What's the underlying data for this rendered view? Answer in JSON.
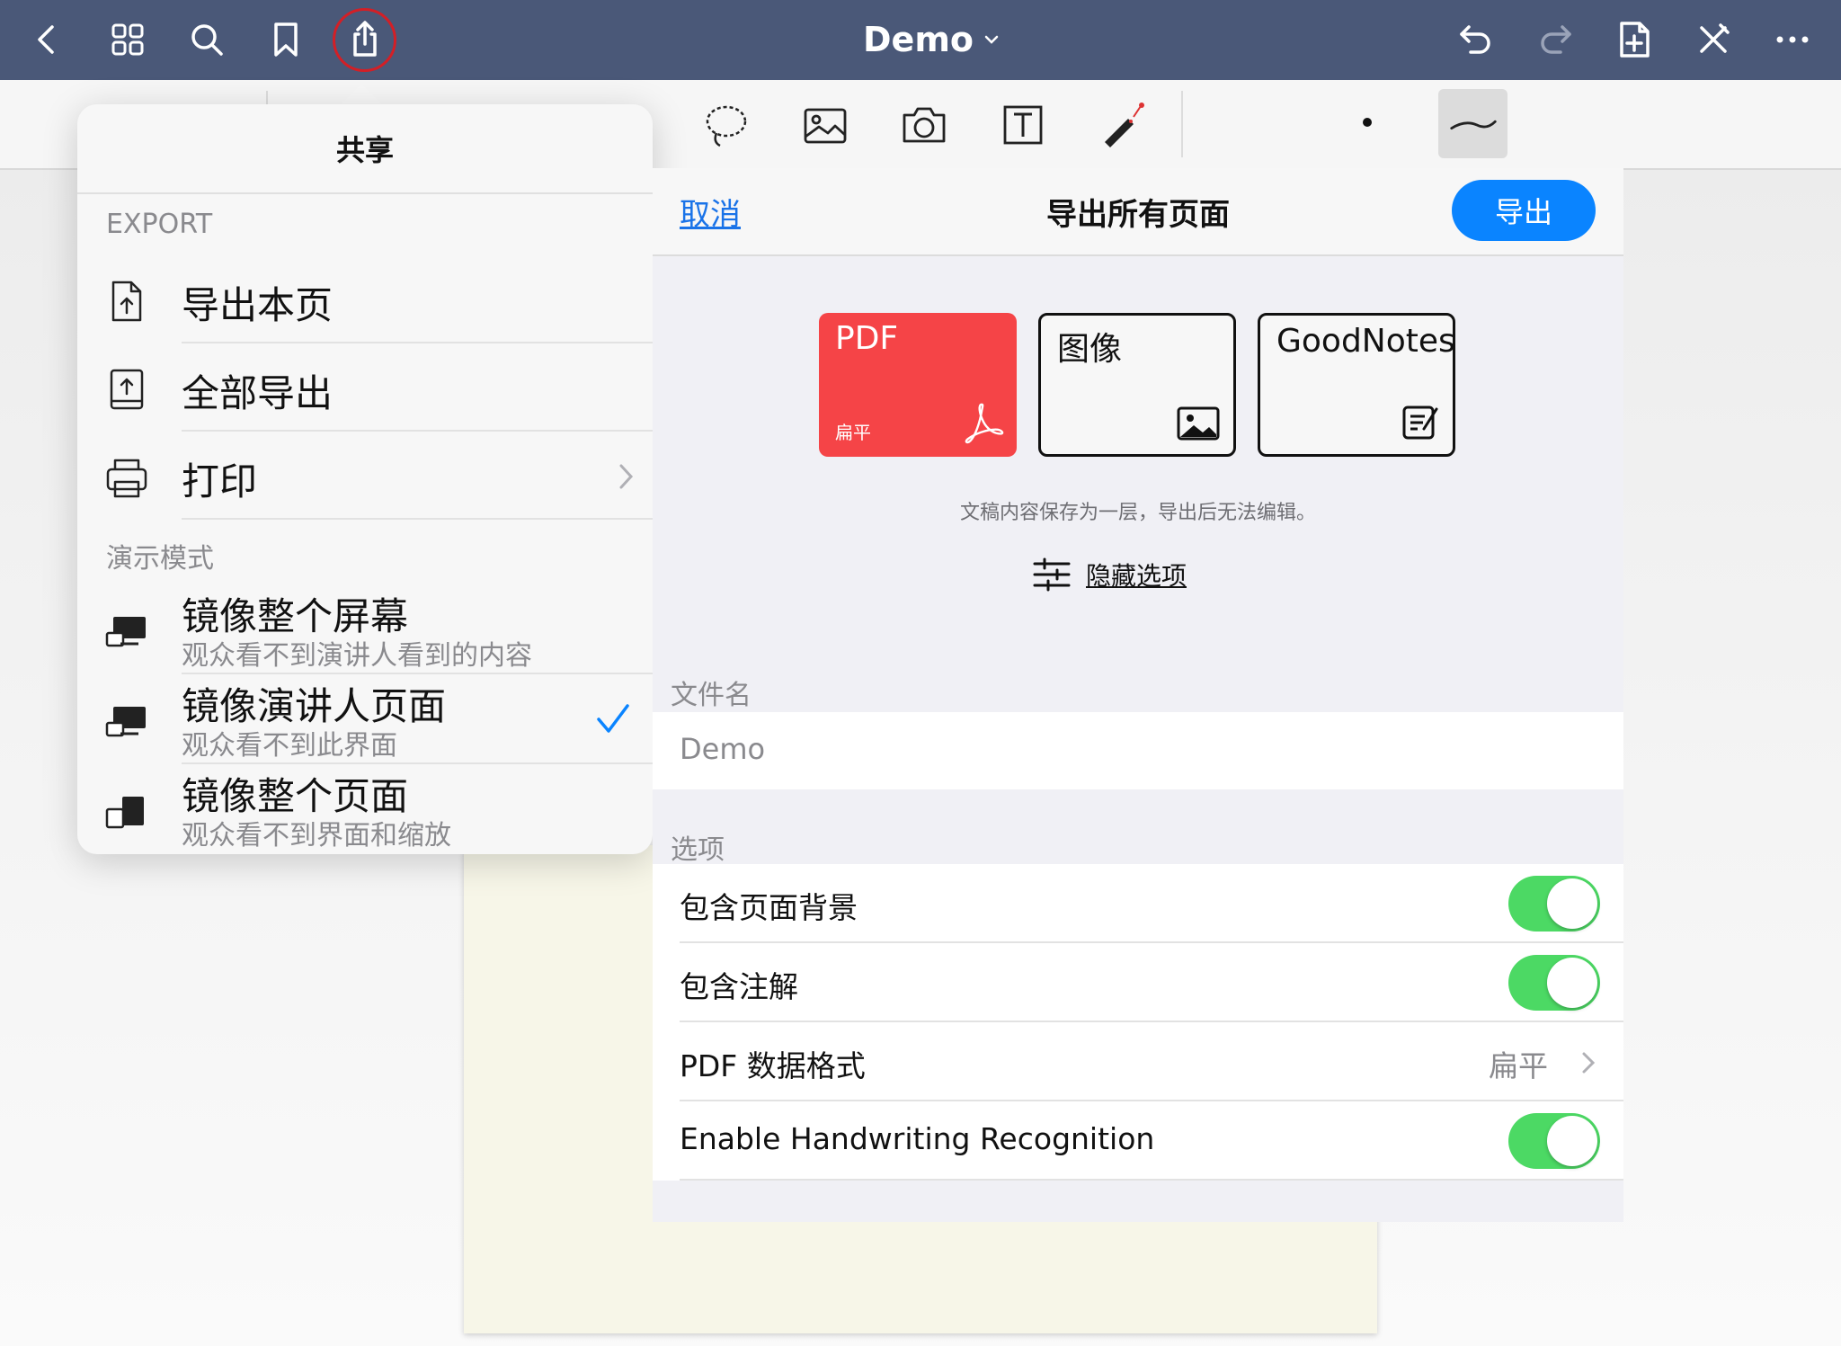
{
  "topbar": {
    "title": "Demo",
    "left_icons": [
      "back-icon",
      "grid-icon",
      "search-icon",
      "bookmark-icon",
      "share-icon"
    ],
    "right_icons": [
      "undo-icon",
      "redo-icon",
      "add-page-icon",
      "close-icon",
      "more-icon"
    ]
  },
  "toolbar": {
    "tools": [
      "lasso-icon",
      "image-icon",
      "camera-icon",
      "text-box-icon",
      "laser-pointer-icon"
    ]
  },
  "share_menu": {
    "title": "共享",
    "export_section": "EXPORT",
    "items": [
      {
        "label": "导出本页",
        "icon": "export-page-icon"
      },
      {
        "label": "全部导出",
        "icon": "export-all-icon"
      },
      {
        "label": "打印",
        "icon": "printer-icon"
      }
    ],
    "presentation_section": "演示模式",
    "presentation_items": [
      {
        "label": "镜像整个屏幕",
        "sub": "观众看不到演讲人看到的内容",
        "selected": false
      },
      {
        "label": "镜像演讲人页面",
        "sub": "观众看不到此界面",
        "selected": true
      },
      {
        "label": "镜像整个页面",
        "sub": "观众看不到界面和缩放",
        "selected": false
      }
    ]
  },
  "export_panel": {
    "cancel": "取消",
    "title": "导出所有页面",
    "export_button": "导出",
    "formats": [
      {
        "name": "PDF",
        "sub": "扁平",
        "selected": true,
        "color": "#f54447"
      },
      {
        "name": "图像",
        "selected": false
      },
      {
        "name": "GoodNotes",
        "selected": false
      }
    ],
    "description": "文稿内容保存为一层，导出后无法编辑。",
    "hide_options": "隐藏选项",
    "filename_label": "文件名",
    "filename_value": "Demo",
    "options_label": "选项",
    "options": [
      {
        "label": "包含页面背景",
        "toggle": true
      },
      {
        "label": "包含注解",
        "toggle": true
      },
      {
        "label": "PDF 数据格式",
        "value": "扁平"
      },
      {
        "label": "Enable Handwriting Recognition",
        "toggle": true
      }
    ]
  },
  "colors": {
    "topbar": "#4a5878",
    "accent_blue": "#0a84ff",
    "toggle_on": "#4cd964",
    "pdf_red": "#f54447",
    "highlight_ring": "#d31f26"
  }
}
